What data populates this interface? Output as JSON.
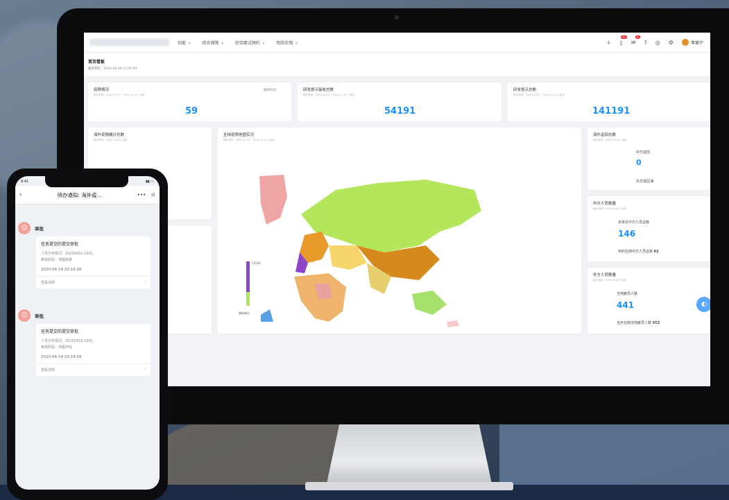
{
  "dashboard": {
    "nav": [
      "功能",
      "综合保障",
      "综合面试预约",
      "风险应用"
    ],
    "user_name": "李某宁",
    "badges": [
      "45",
      "6"
    ],
    "page_title": "首页看板",
    "page_updated": "最后更新：2020-06-08 13:29:43",
    "cards": {
      "c1": {
        "title": "疫情情况",
        "sub": "统计时间：2020-01-20 ~ 2020-12-31 | 全年",
        "value": "59",
        "extra": "最新时间"
      },
      "c2": {
        "title": "研发提示接收总数",
        "sub": "统计时间：2020-01-20 ~ 2020-12-31 | 全年",
        "value": "54191"
      },
      "c3": {
        "title": "研发提示总数",
        "sub": "统计时间：2020-01-20 ~ 2020-12-31 | 全年",
        "value": "141191"
      },
      "c4": {
        "title": "海外疫情确诊总数",
        "sub": "统计时间：2020-04-08 | 全年"
      },
      "map": {
        "title": "全球疫情地图实况",
        "sub": "统计时间：2020-01-20 ~ 2020-12-31 | 全年",
        "legend_top": "15000",
        "legend_bottom": "最新确诊"
      },
      "r1": {
        "title": "海外返回总数",
        "sub": "统计时间：2020-04-08 | 全年",
        "l1": "中方返回",
        "v1": "0",
        "l2": "外方返回",
        "v2": "0"
      },
      "r2": {
        "title": "中方人员数量",
        "sub": "统计时间：2020-04-08 | 全年",
        "l1": "本单位中方人员总数",
        "v1": "146",
        "l2": "实时在岗中方人员总数",
        "v2": "62"
      },
      "r3": {
        "title": "外方人员数量",
        "sub": "统计时间：2020-04-08 | 全年",
        "l1": "当地雇员人数",
        "v1": "441",
        "l2": "当天在岗当地雇员人数",
        "v2": "553"
      }
    }
  },
  "phone": {
    "time": "9:41",
    "header_title": "待办通知: 海外疫...",
    "messages": [
      {
        "label": "审批",
        "title": "任务提交的提交审批",
        "line1": "人员分布情况：20200416-29日；",
        "line2": "审批阶段：流程结束",
        "time": "2020-04-14 23:10:26",
        "footer": "查看详情"
      },
      {
        "label": "审批",
        "title": "任务提交的提交审批",
        "line1": "人员分布情况：20200416-29日；",
        "line2": "审批阶段：流程开始",
        "time": "2020-04-14 23:14:29",
        "footer": "查看详情"
      }
    ]
  }
}
